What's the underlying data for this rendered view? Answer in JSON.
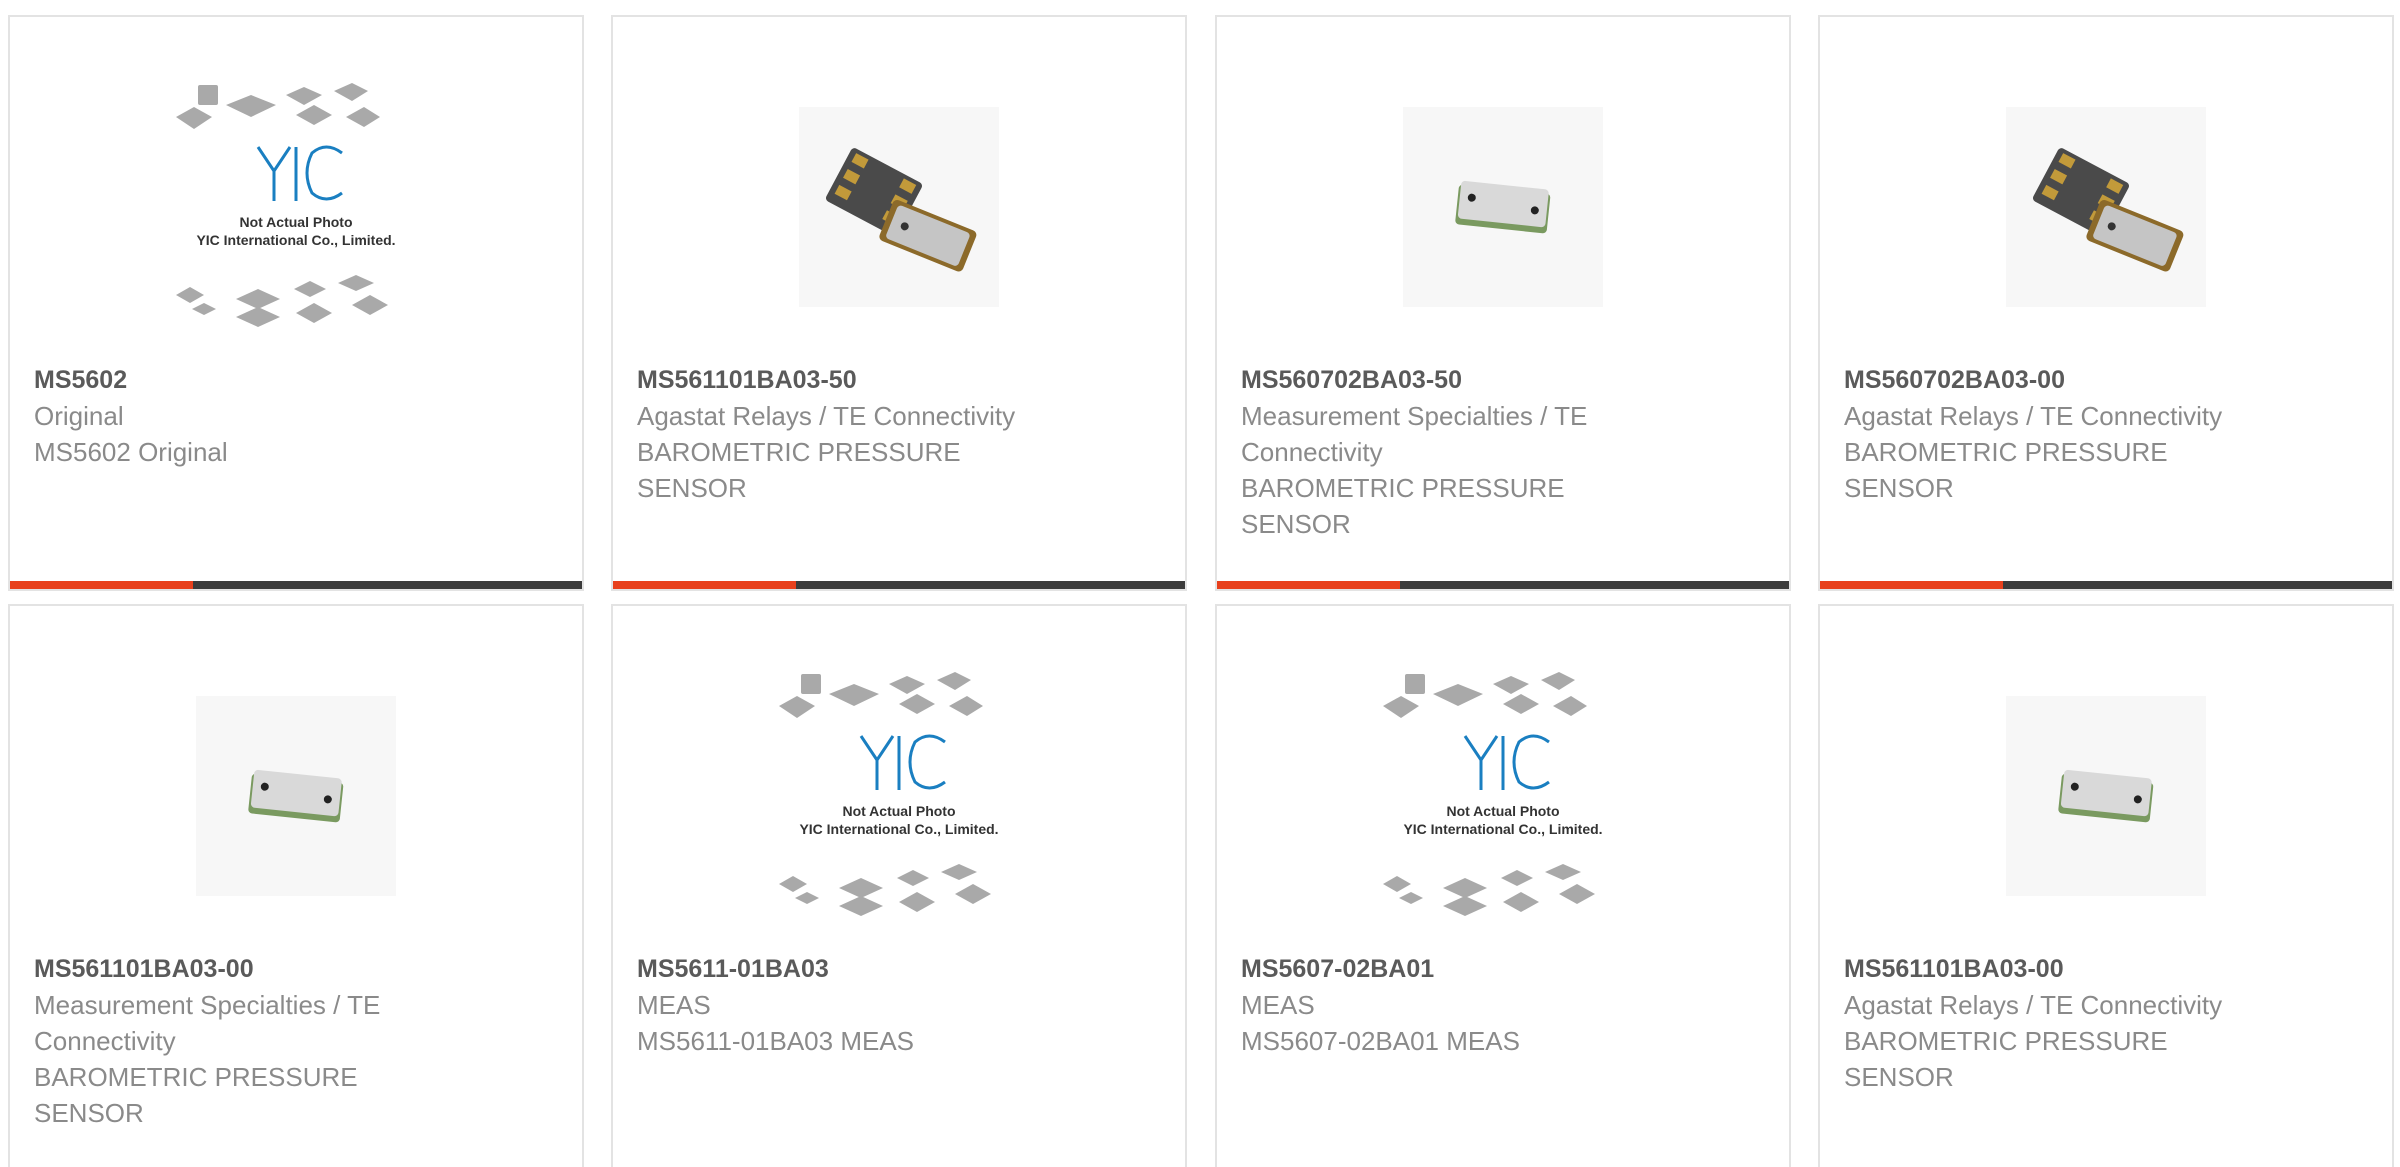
{
  "products": [
    {
      "part": "MS5602",
      "lines": [
        "Original",
        "MS5602 Original"
      ],
      "image": "placeholder",
      "placeholder_text": [
        "Not Actual Photo",
        "YIC International Co., Limited."
      ]
    },
    {
      "part": "MS561101BA03-50",
      "lines": [
        "Agastat Relays / TE Connectivity",
        "BAROMETRIC PRESSURE",
        "SENSOR"
      ],
      "image": "two-chips"
    },
    {
      "part": "MS560702BA03-50",
      "lines": [
        "Measurement Specialties / TE",
        "Connectivity",
        "BAROMETRIC PRESSURE",
        "SENSOR"
      ],
      "image": "single-sensor"
    },
    {
      "part": "MS560702BA03-00",
      "lines": [
        "Agastat Relays / TE Connectivity",
        "BAROMETRIC PRESSURE",
        "SENSOR"
      ],
      "image": "two-chips"
    },
    {
      "part": "MS561101BA03-00",
      "lines": [
        "Measurement Specialties / TE",
        "Connectivity",
        "BAROMETRIC PRESSURE",
        "SENSOR"
      ],
      "image": "single-sensor"
    },
    {
      "part": "MS5611-01BA03",
      "lines": [
        "MEAS",
        "MS5611-01BA03 MEAS"
      ],
      "image": "placeholder",
      "placeholder_text": [
        "Not Actual Photo",
        "YIC International Co., Limited."
      ]
    },
    {
      "part": "MS5607-02BA01",
      "lines": [
        "MEAS",
        "MS5607-02BA01 MEAS"
      ],
      "image": "placeholder",
      "placeholder_text": [
        "Not Actual Photo",
        "YIC International Co., Limited."
      ]
    },
    {
      "part": "MS561101BA03-00",
      "lines": [
        "Agastat Relays / TE Connectivity",
        "BAROMETRIC PRESSURE",
        "SENSOR"
      ],
      "image": "single-sensor"
    }
  ],
  "colors": {
    "accent": "#e8401c",
    "bar": "#3b3b3b",
    "title": "#5a5a5a",
    "text": "#8a8a8a",
    "logo_blue": "#1a7fc1"
  }
}
